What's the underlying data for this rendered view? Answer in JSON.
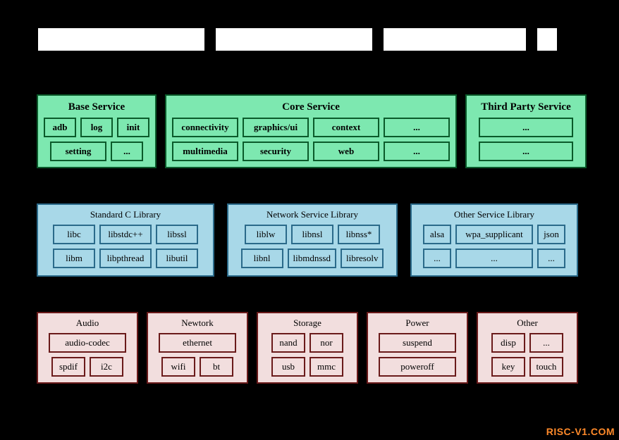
{
  "top_boxes": [
    "",
    "",
    "",
    ""
  ],
  "services": {
    "base": {
      "title": "Base Service",
      "row1": [
        "adb",
        "log",
        "init"
      ],
      "row2": [
        "setting",
        "..."
      ]
    },
    "core": {
      "title": "Core Service",
      "row1": [
        "connectivity",
        "graphics/ui",
        "context",
        "..."
      ],
      "row2": [
        "multimedia",
        "security",
        "web",
        "..."
      ]
    },
    "third": {
      "title": "Third Party Service",
      "row1": [
        "..."
      ],
      "row2": [
        "..."
      ]
    }
  },
  "libs": {
    "std": {
      "title": "Standard C Library",
      "row1": [
        "libc",
        "libstdc++",
        "libssl"
      ],
      "row2": [
        "libm",
        "libpthread",
        "libutil"
      ]
    },
    "net": {
      "title": "Network Service Library",
      "row1": [
        "liblw",
        "libnsl",
        "libnss*"
      ],
      "row2": [
        "libnl",
        "libmdnssd",
        "libresolv"
      ]
    },
    "other": {
      "title": "Other Service Library",
      "row1": [
        "alsa",
        "wpa_supplicant",
        "json"
      ],
      "row2": [
        "...",
        "...",
        "..."
      ]
    }
  },
  "kernel": {
    "audio": {
      "title": "Audio",
      "row1": [
        "audio-codec"
      ],
      "row2": [
        "spdif",
        "i2c"
      ]
    },
    "network": {
      "title": "Newtork",
      "row1": [
        "ethernet"
      ],
      "row2": [
        "wifi",
        "bt"
      ]
    },
    "storage": {
      "title": "Storage",
      "row1": [
        "nand",
        "nor"
      ],
      "row2": [
        "usb",
        "mmc"
      ]
    },
    "power": {
      "title": "Power",
      "row1": [
        "suspend"
      ],
      "row2": [
        "poweroff"
      ]
    },
    "other": {
      "title": "Other",
      "row1": [
        "disp",
        "..."
      ],
      "row2": [
        "key",
        "touch"
      ]
    }
  },
  "watermark": "RISC-V1.COM"
}
